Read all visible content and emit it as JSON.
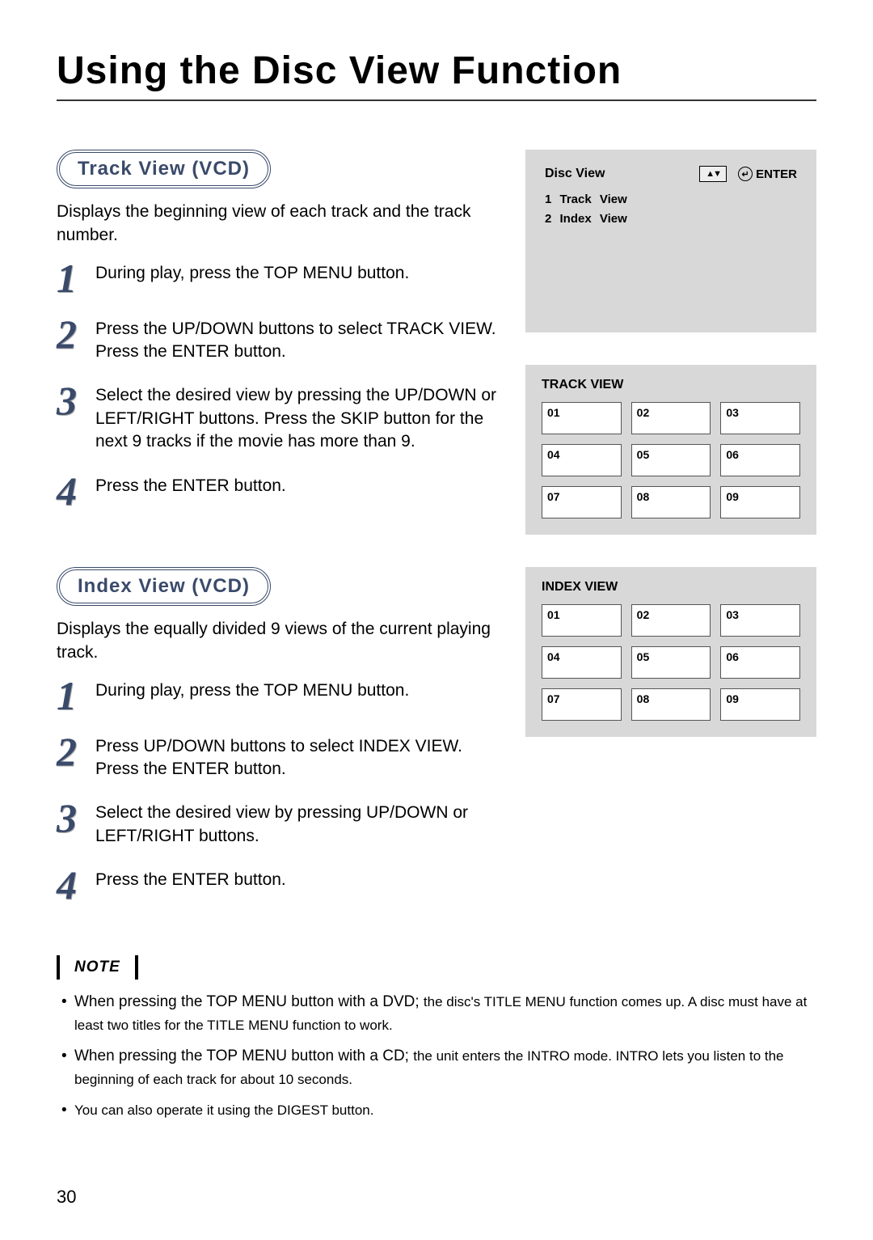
{
  "page": {
    "title": "Using the Disc View Function",
    "number": "30"
  },
  "sections": {
    "track": {
      "label": "Track View (VCD)",
      "intro": "Displays the beginning view of each track and the track number.",
      "steps": [
        {
          "n": "1",
          "text": "During play, press the TOP MENU button."
        },
        {
          "n": "2",
          "text": "Press the UP/DOWN buttons to select TRACK VIEW. Press the ENTER button."
        },
        {
          "n": "3",
          "text": "Select the desired view by pressing the UP/DOWN or LEFT/RIGHT buttons. Press the SKIP button for the next 9 tracks if the movie has more than 9."
        },
        {
          "n": "4",
          "text": "Press the ENTER button."
        }
      ]
    },
    "index": {
      "label": "Index View (VCD)",
      "intro": "Displays the equally divided 9 views of the current playing track.",
      "steps": [
        {
          "n": "1",
          "text": "During play, press the TOP MENU button."
        },
        {
          "n": "2",
          "text": "Press UP/DOWN buttons to select INDEX VIEW. Press the ENTER button."
        },
        {
          "n": "3",
          "text": "Select the desired view by pressing UP/DOWN or LEFT/RIGHT buttons."
        },
        {
          "n": "4",
          "text": "Press the ENTER button."
        }
      ]
    }
  },
  "osd": {
    "disc_view_title": "Disc View",
    "enter_label": "ENTER",
    "menu_items": [
      "1 Track View",
      "2 Index View"
    ],
    "track_grid_title": "TRACK VIEW",
    "index_grid_title": "INDEX VIEW",
    "cells": [
      "01",
      "02",
      "03",
      "04",
      "05",
      "06",
      "07",
      "08",
      "09"
    ]
  },
  "note": {
    "label": "NOTE",
    "items": [
      {
        "lead": "When pressing the TOP MENU button with a DVD; ",
        "tail": "the disc's TITLE MENU function comes up. A disc must have at least two titles for the TITLE MENU function to work."
      },
      {
        "lead": "When pressing the TOP MENU button with a CD; ",
        "tail": "the unit enters the INTRO mode. INTRO lets you listen to the beginning of each track for about 10 seconds."
      },
      {
        "lead": "",
        "tail": "You can also operate it using the DIGEST button."
      }
    ]
  }
}
